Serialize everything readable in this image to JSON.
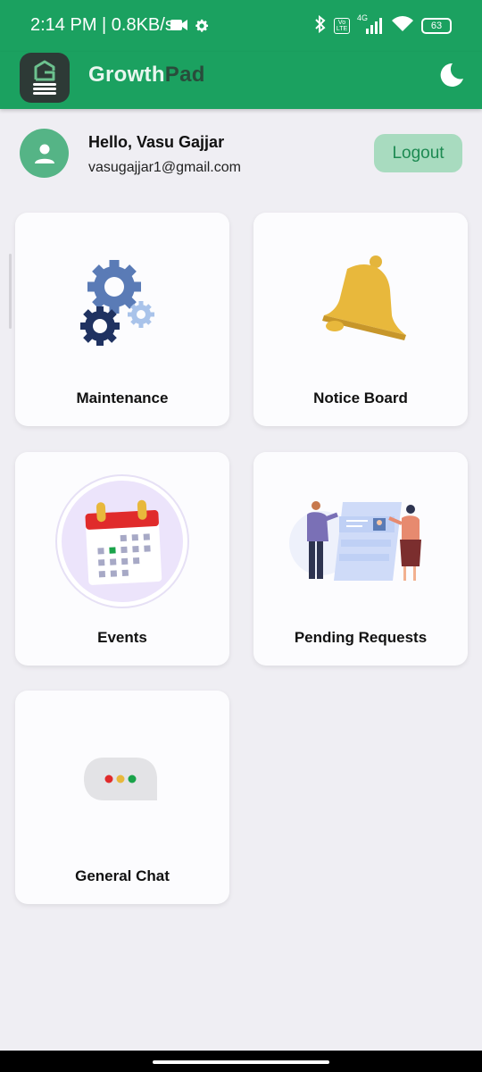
{
  "status_bar": {
    "time_speed": "2:14 PM | 0.8KB/s",
    "network": "4G",
    "volte": "Vo LTE",
    "battery": "63",
    "icons": [
      "video-icon",
      "gear-icon",
      "bluetooth-icon",
      "volte-icon",
      "signal-icon",
      "wifi-icon",
      "battery-icon"
    ]
  },
  "app_bar": {
    "title_part1": "Growth",
    "title_part2": "Pad",
    "icons": [
      "growthpad-logo",
      "moon-icon"
    ]
  },
  "profile": {
    "greeting": "Hello, Vasu Gajjar",
    "email": "vasugajjar1@gmail.com",
    "logout_label": "Logout"
  },
  "cards": [
    {
      "label": "Maintenance",
      "icon": "gears-icon"
    },
    {
      "label": "Notice Board",
      "icon": "bell-icon"
    },
    {
      "label": "Events",
      "icon": "calendar-icon"
    },
    {
      "label": "Pending Requests",
      "icon": "pending-requests-illustration"
    },
    {
      "label": "General Chat",
      "icon": "chat-bubble-icon"
    }
  ],
  "colors": {
    "primary": "#1ba160",
    "background": "#efeef3",
    "card": "#fcfcfe",
    "logout_bg": "#a8dbbf",
    "logout_text": "#1d8a52"
  }
}
